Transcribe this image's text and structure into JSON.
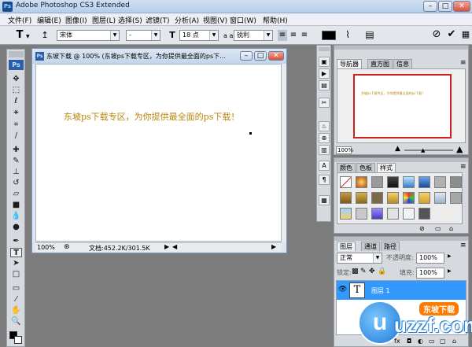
{
  "app": {
    "title": "Adobe Photoshop CS3 Extended",
    "logo": "Ps"
  },
  "menu": [
    "文件(F)",
    "编辑(E)",
    "图像(I)",
    "图层(L)",
    "选择(S)",
    "滤镜(T)",
    "分析(A)",
    "视图(V)",
    "窗口(W)",
    "帮助(H)"
  ],
  "options": {
    "tool_letter": "T",
    "font_family": "宋体",
    "font_style": "-",
    "font_size": "18 点",
    "aa_label": "a a",
    "aa_value": "锐利"
  },
  "document": {
    "title": "东坡下载 @ 100% (东坡ps下载专区，为你提供最全面的ps下...",
    "canvas_text": "东坡ps下载专区，为你提供最全面的ps下载！",
    "zoom": "100%",
    "doc_size": "文档:452.2K/301.5K"
  },
  "navigator": {
    "tabs": [
      "导航器",
      "直方图",
      "信息"
    ],
    "preview_text": "东坡ps下载专区，为你提供最全面的ps下载！",
    "zoom": "100%"
  },
  "styles_panel": {
    "tabs": [
      "颜色",
      "色板",
      "样式"
    ]
  },
  "layers_panel": {
    "tabs": [
      "图层",
      "通道",
      "路径"
    ],
    "blend_mode": "正常",
    "opacity_label": "不透明度:",
    "opacity_value": "100%",
    "lock_label": "锁定:",
    "fill_label": "填充:",
    "fill_value": "100%",
    "layer_name": "图层 1",
    "layer_thumb": "T"
  },
  "watermark": {
    "brand": "uzzf.com",
    "badge": "东坡下载"
  },
  "colors": {
    "accent": "#3399ff",
    "canvas_text": "#b8860b",
    "nav_frame": "#cc2222"
  }
}
